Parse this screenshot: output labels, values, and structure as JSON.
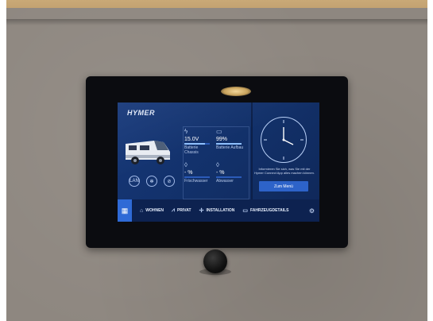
{
  "brand": {
    "logo_text": "HYMER"
  },
  "tiles": [
    {
      "icon": "lightning-icon",
      "value": "15.0V",
      "label": "Batterie Chassis",
      "fill": 0.8
    },
    {
      "icon": "battery-icon",
      "value": "99%",
      "label": "Batterie Aufbau",
      "fill": 0.99
    },
    {
      "icon": "water-drop-icon",
      "value": "- %",
      "label": "Frischwasser",
      "fill": 0
    },
    {
      "icon": "water-drop-icon",
      "value": "- %",
      "label": "Abwasser",
      "fill": 0
    }
  ],
  "status_icons": [
    "LAN",
    "✻",
    "⊘"
  ],
  "info_panel": {
    "text": "Informieren Sie sich, was Sie mit der Hymer Connect App alles machen können.",
    "button_label": "Zum Menü"
  },
  "nav": {
    "items": [
      {
        "label": "WOHNEN",
        "icon": "camper-icon"
      },
      {
        "label": "PRIVAT",
        "icon": "chart-icon"
      },
      {
        "label": "INSTALLATION",
        "icon": "tools-icon"
      },
      {
        "label": "FAHRZEUGDETAILS",
        "icon": "vehicle-icon"
      }
    ]
  },
  "colors": {
    "screen_bg": "#16387a",
    "accent": "#2f6ad6",
    "nav_bg": "#0d2250"
  }
}
